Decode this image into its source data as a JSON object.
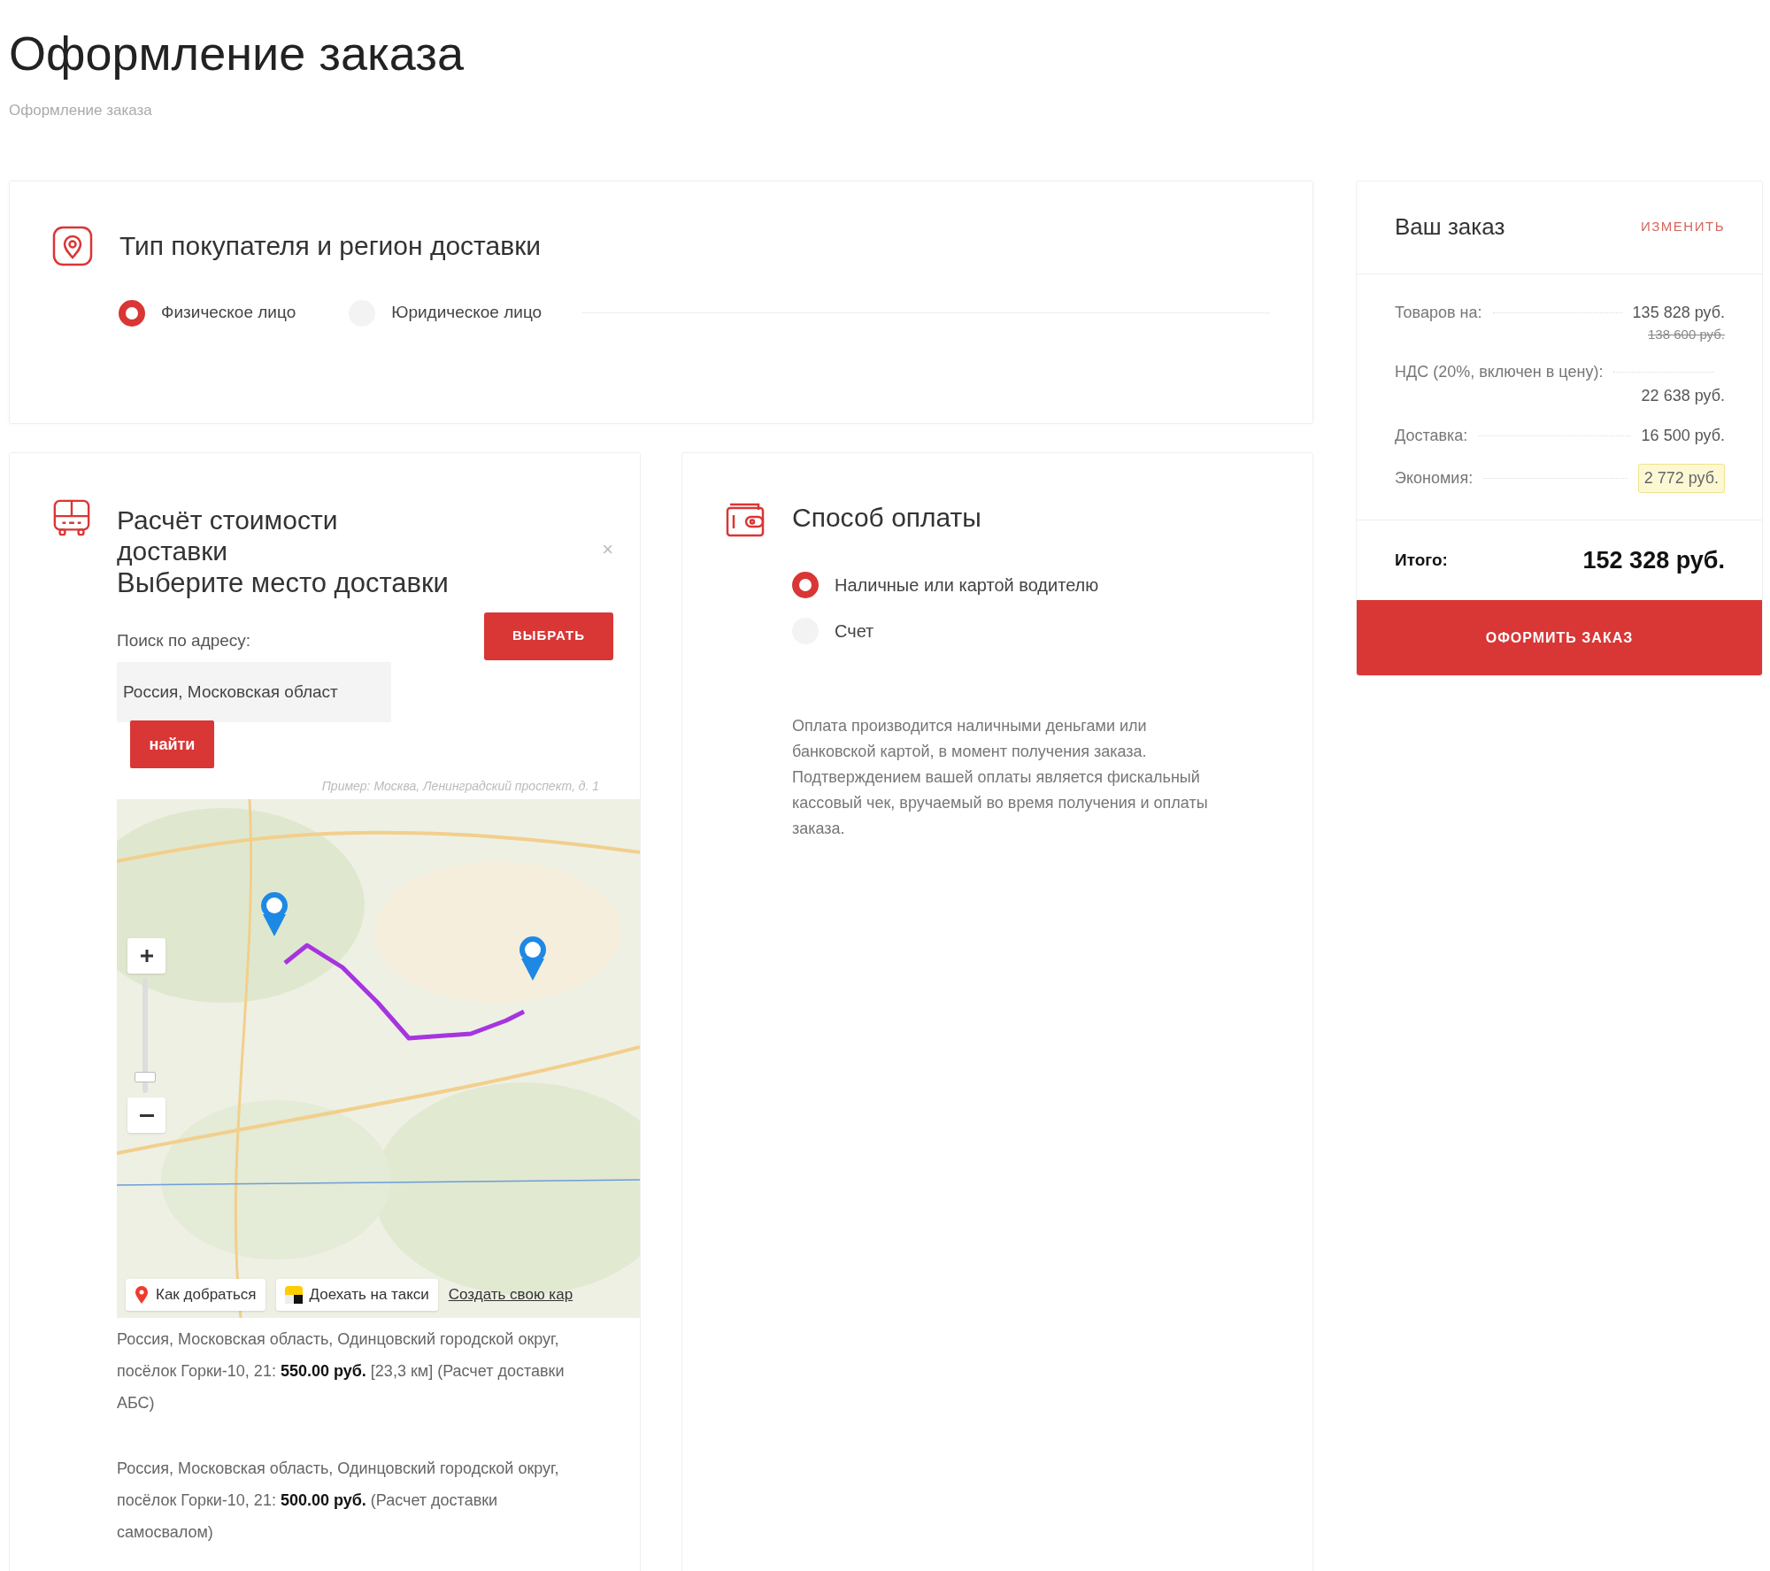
{
  "page_title": "Оформление заказа",
  "breadcrumb": "Оформление заказа",
  "buyer_section": {
    "title": "Тип покупателя и регион доставки",
    "buyer_types": [
      {
        "label": "Физическое лицо",
        "selected": true
      },
      {
        "label": "Юридическое лицо",
        "selected": false
      }
    ]
  },
  "delivery_section": {
    "title": "Расчёт стоимости доставки",
    "subtitle": "Выберите место доставки",
    "close": "×",
    "search_label": "Поиск по адресу:",
    "search_value": "Россия, Московская област",
    "find_button": "найти",
    "select_button": "ВЫБРАТЬ",
    "hint": "Пример: Москва, Ленинградский проспект, д. 1",
    "map": {
      "zoom_slider": {
        "level": 0.14
      },
      "route_button": "Как добраться",
      "taxi_button": "Доехать на такси",
      "create_map_link": "Создать свою кар"
    },
    "results": [
      "Россия, Московская область, Одинцовский городской округ, посёлок Горки-10, 21: **550.00 руб.** [23,3 км] (Расчет доставки АБС)",
      "Россия, Московская область, Одинцовский городской округ, посёлок Горки-10, 21: **500.00 руб.** (Расчет доставки самосвалом)"
    ]
  },
  "payment_section": {
    "title": "Способ оплаты",
    "methods": [
      {
        "label": "Наличные или картой водителю",
        "selected": true
      },
      {
        "label": "Счет",
        "selected": false
      }
    ],
    "description": "Оплата производится наличными деньгами или банковской картой, в момент получения заказа. Подтверждением вашей оплаты является фискальный кассовый чек, вручаемый во время получения и оплаты заказа."
  },
  "order_summary": {
    "title": "Ваш заказ",
    "edit_link": "ИЗМЕНИТЬ",
    "rows": [
      {
        "label": "Товаров на:",
        "value": "135 828 руб.",
        "old_value": "138 600 руб.",
        "highlighted": false
      },
      {
        "label": "НДС (20%, включен в цену):",
        "value": "22 638 руб.",
        "highlighted": false
      },
      {
        "label": "Доставка:",
        "value": "16 500 руб.",
        "highlighted": false
      },
      {
        "label": "Экономия:",
        "value": "2 772 руб.",
        "highlighted": true
      }
    ],
    "total_label": "Итого:",
    "total_value": "152 328 руб.",
    "checkout_button": "ОФОРМИТЬ ЗАКАЗ"
  }
}
